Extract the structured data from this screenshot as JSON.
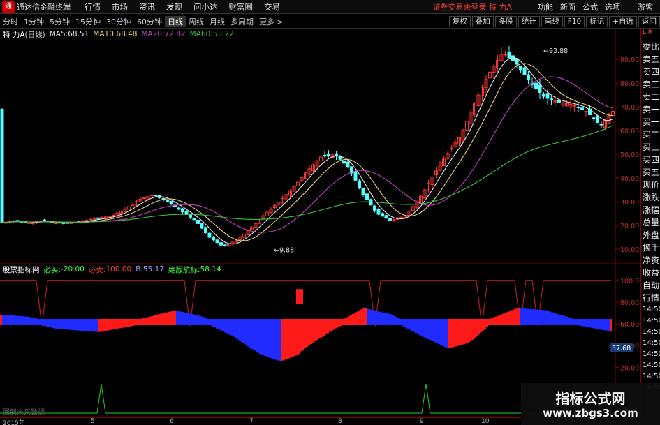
{
  "menubar": {
    "title": "通达信金融终端",
    "items": [
      "行情",
      "市场",
      "资讯",
      "发现",
      "问小达",
      "财富圈",
      "交易"
    ],
    "notice": "证券交易未登录 特 力A",
    "right": [
      "功能",
      "新面",
      "公式",
      "选项"
    ],
    "guest": "游客",
    "logo": "通"
  },
  "timeframes": [
    "分时",
    "1分钟",
    "5分钟",
    "15分钟",
    "30分钟",
    "60分钟",
    "日线",
    "周线",
    "月线",
    "多周期",
    "更多 >"
  ],
  "selected_timeframe": "日线",
  "tools": [
    "复权",
    "叠加",
    "多股",
    "统计",
    "画线",
    "F10",
    "标记",
    "+自选",
    "返回"
  ],
  "main": {
    "stock": "特 力A",
    "period": "(日线)",
    "ma": [
      {
        "label": "MA5:",
        "value": "68.51",
        "color": "#e8e8e8"
      },
      {
        "label": "MA10:",
        "value": "68.48",
        "color": "#e8d27a"
      },
      {
        "label": "MA20:",
        "value": "72.82",
        "color": "#c040c0"
      },
      {
        "label": "MA60:",
        "value": "53.22",
        "color": "#40c040"
      }
    ],
    "high_label": "93.88",
    "low_label": "9.88",
    "yticks": [
      "90.00",
      "80.00",
      "70.00",
      "60.00",
      "50.00",
      "40.00",
      "30.00",
      "20.00",
      "10.00"
    ],
    "corner": "L R"
  },
  "indicator": {
    "name": "股票指标网",
    "items": [
      {
        "label": "必买:",
        "value": "-20.00",
        "color": "#40ff40"
      },
      {
        "label": "必卖:",
        "value": "100.00",
        "color": "#ff4040"
      },
      {
        "label": "B:",
        "value": "55.17",
        "color": "#a0a0ff"
      },
      {
        "label": "绝版航标:",
        "value": "58.14",
        "color": "#40ff40"
      }
    ],
    "yticks": [
      "100.00",
      "80.00",
      "60.00",
      "40.00",
      "20.00"
    ],
    "current": "37.68",
    "nodata": "回到未来数据"
  },
  "sidebar": {
    "items": [
      "委比",
      "卖五",
      "卖四",
      "卖三",
      "卖二",
      "卖一",
      "买一",
      "买二",
      "买三",
      "买四",
      "买五",
      "现价",
      "涨跌",
      "涨幅",
      "总量",
      "外盘",
      "换手",
      "净资",
      "收益",
      "自动",
      "行情",
      "14:50",
      "14:50",
      "14:50",
      "14:50",
      "14:50",
      "14:50",
      "14:50",
      "14:50"
    ]
  },
  "xaxis": {
    "labels": [
      "2015年",
      "5",
      "6",
      "7",
      "8",
      "9",
      "10"
    ]
  },
  "watermark": {
    "line1": "指标公式网",
    "line2": "www.zbgs3.com"
  },
  "chart_data": {
    "type": "candlestick",
    "price_range": [
      5,
      98
    ],
    "high": 93.88,
    "low": 9.88,
    "close_path": [
      [
        0,
        21
      ],
      [
        20,
        22
      ],
      [
        40,
        21
      ],
      [
        60,
        22
      ],
      [
        80,
        21
      ],
      [
        100,
        21
      ],
      [
        120,
        22
      ],
      [
        140,
        23
      ],
      [
        160,
        24
      ],
      [
        180,
        27
      ],
      [
        200,
        31
      ],
      [
        220,
        33
      ],
      [
        240,
        30
      ],
      [
        260,
        26
      ],
      [
        280,
        22
      ],
      [
        300,
        15
      ],
      [
        320,
        11
      ],
      [
        340,
        14
      ],
      [
        360,
        19
      ],
      [
        380,
        25
      ],
      [
        400,
        30
      ],
      [
        420,
        36
      ],
      [
        440,
        43
      ],
      [
        460,
        49
      ],
      [
        480,
        50
      ],
      [
        500,
        44
      ],
      [
        520,
        33
      ],
      [
        540,
        25
      ],
      [
        560,
        22
      ],
      [
        580,
        24
      ],
      [
        600,
        31
      ],
      [
        620,
        41
      ],
      [
        640,
        50
      ],
      [
        660,
        58
      ],
      [
        680,
        72
      ],
      [
        700,
        84
      ],
      [
        720,
        93
      ],
      [
        740,
        88
      ],
      [
        760,
        80
      ],
      [
        780,
        74
      ],
      [
        800,
        72
      ],
      [
        820,
        71
      ],
      [
        840,
        68
      ],
      [
        860,
        62
      ],
      [
        880,
        69
      ]
    ]
  }
}
